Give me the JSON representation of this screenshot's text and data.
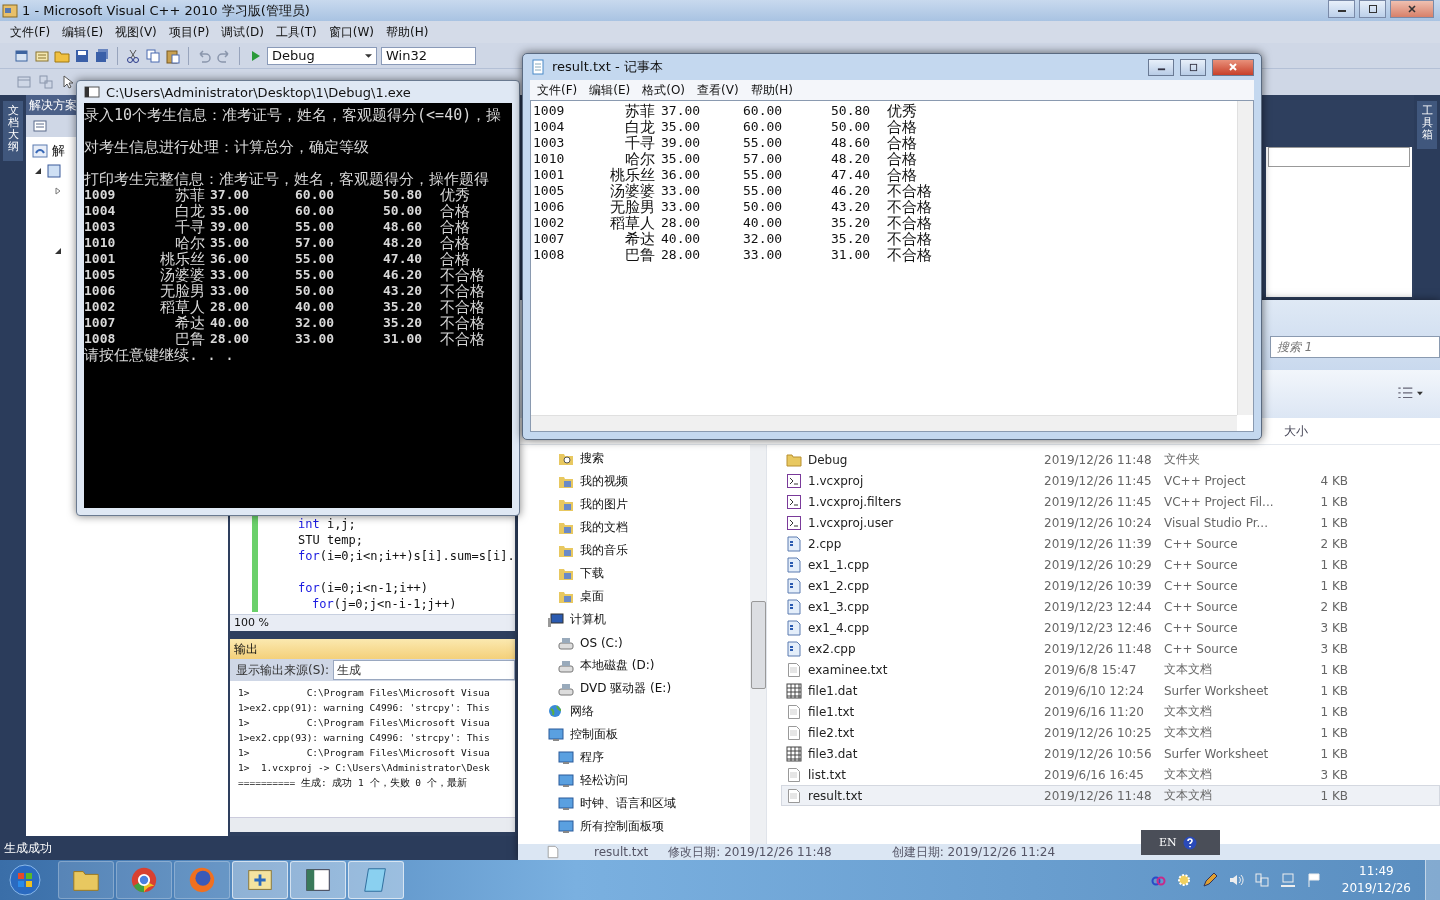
{
  "vs": {
    "title": "1 - Microsoft Visual C++ 2010 学习版(管理员)",
    "menu": [
      "文件(F)",
      "编辑(E)",
      "视图(V)",
      "项目(P)",
      "调试(D)",
      "工具(T)",
      "窗口(W)",
      "帮助(H)"
    ],
    "config": "Debug",
    "platform": "Win32",
    "left_tab": "文档大纲",
    "right_tab": "工具箱",
    "solution_explorer": {
      "title": "解决方案",
      "root": "解"
    },
    "code_blocks": [
      [
        {
          "tokens": [
            {
              "text": "int",
              "kind": "keyword"
            },
            {
              "text": " i,j;",
              "kind": "plain"
            }
          ]
        },
        {
          "tokens": [
            {
              "text": "STU temp;",
              "kind": "plain"
            }
          ]
        },
        {
          "tokens": [
            {
              "text": "for",
              "kind": "keyword"
            },
            {
              "text": "(i=0;i<n;i++)s[i].sum=s[i].",
              "kind": "plain"
            }
          ]
        }
      ],
      [
        {
          "tokens": [
            {
              "text": "for",
              "kind": "keyword"
            },
            {
              "text": "(i=0;i<n-1;i++)",
              "kind": "plain"
            }
          ],
          "children": [
            {
              "tokens": [
                {
                  "text": "for",
                  "kind": "keyword"
                },
                {
                  "text": "(j=0;j<n-i-1;j++)",
                  "kind": "plain"
                }
              ]
            }
          ]
        }
      ]
    ],
    "zoom": "100 %",
    "output": {
      "title": "输出",
      "source_label": "显示输出来源(S):",
      "source": "生成",
      "lines": [
        "1>          C:\\Program Files\\Microsoft Visua",
        "1>ex2.cpp(91): warning C4996: 'strcpy': This",
        "1>          C:\\Program Files\\Microsoft Visua",
        "1>ex2.cpp(93): warning C4996: 'strcpy': This",
        "1>          C:\\Program Files\\Microsoft Visua",
        "1>  1.vcxproj -> C:\\Users\\Administrator\\Desk",
        "========== 生成: 成功 1 个，失败 0 个，最新"
      ]
    },
    "status": "生成成功"
  },
  "console": {
    "title": "C:\\Users\\Administrator\\Desktop\\1\\Debug\\1.exe",
    "intro": [
      "录入10个考生信息：准考证号，姓名，客观题得分(<=40)，操",
      "对考生信息进行处理：计算总分，确定等级",
      "打印考生完整信息：准考证号，姓名，客观题得分，操作题得"
    ],
    "rows": [
      [
        "1009",
        "苏菲",
        "37.00",
        "60.00",
        "50.80",
        "优秀"
      ],
      [
        "1004",
        "白龙",
        "35.00",
        "60.00",
        "50.00",
        "合格"
      ],
      [
        "1003",
        "千寻",
        "39.00",
        "55.00",
        "48.60",
        "合格"
      ],
      [
        "1010",
        "哈尔",
        "35.00",
        "57.00",
        "48.20",
        "合格"
      ],
      [
        "1001",
        "桃乐丝",
        "36.00",
        "55.00",
        "47.40",
        "合格"
      ],
      [
        "1005",
        "汤婆婆",
        "33.00",
        "55.00",
        "46.20",
        "不合格"
      ],
      [
        "1006",
        "无脸男",
        "33.00",
        "50.00",
        "43.20",
        "不合格"
      ],
      [
        "1002",
        "稻草人",
        "28.00",
        "40.00",
        "35.20",
        "不合格"
      ],
      [
        "1007",
        "希达",
        "40.00",
        "32.00",
        "35.20",
        "不合格"
      ],
      [
        "1008",
        "巴鲁",
        "28.00",
        "33.00",
        "31.00",
        "不合格"
      ]
    ],
    "prompt": "请按任意键继续. . ."
  },
  "notepad": {
    "title": "result.txt - 记事本",
    "menu": [
      "文件(F)",
      "编辑(E)",
      "格式(O)",
      "查看(V)",
      "帮助(H)"
    ],
    "rows": [
      [
        "1009",
        "苏菲",
        "37.00",
        "60.00",
        "50.80",
        "优秀"
      ],
      [
        "1004",
        "白龙",
        "35.00",
        "60.00",
        "50.00",
        "合格"
      ],
      [
        "1003",
        "千寻",
        "39.00",
        "55.00",
        "48.60",
        "合格"
      ],
      [
        "1010",
        "哈尔",
        "35.00",
        "57.00",
        "48.20",
        "合格"
      ],
      [
        "1001",
        "桃乐丝",
        "36.00",
        "55.00",
        "47.40",
        "合格"
      ],
      [
        "1005",
        "汤婆婆",
        "33.00",
        "55.00",
        "46.20",
        "不合格"
      ],
      [
        "1006",
        "无脸男",
        "33.00",
        "50.00",
        "43.20",
        "不合格"
      ],
      [
        "1002",
        "稻草人",
        "28.00",
        "40.00",
        "35.20",
        "不合格"
      ],
      [
        "1007",
        "希达",
        "40.00",
        "32.00",
        "35.20",
        "不合格"
      ],
      [
        "1008",
        "巴鲁",
        "28.00",
        "33.00",
        "31.00",
        "不合格"
      ]
    ]
  },
  "explorer": {
    "search": {
      "placeholder": "搜索 1"
    },
    "size_header": "大小",
    "nav_upper": [
      {
        "label": "搜索",
        "kind": "search"
      },
      {
        "label": "我的视频",
        "kind": "library"
      },
      {
        "label": "我的图片",
        "kind": "library"
      },
      {
        "label": "我的文档",
        "kind": "library"
      },
      {
        "label": "我的音乐",
        "kind": "library"
      },
      {
        "label": "下载",
        "kind": "library"
      },
      {
        "label": "桌面",
        "kind": "library"
      }
    ],
    "nav_tree": [
      {
        "label": "计算机",
        "kind": "computer",
        "children": [
          {
            "label": "OS (C:)",
            "kind": "drive"
          },
          {
            "label": "本地磁盘 (D:)",
            "kind": "drive"
          },
          {
            "label": "DVD 驱动器 (E:)",
            "kind": "drive"
          }
        ]
      },
      {
        "label": "网络",
        "kind": "network"
      },
      {
        "label": "控制面板",
        "kind": "panel",
        "children": [
          {
            "label": "程序",
            "kind": "panel"
          },
          {
            "label": "轻松访问",
            "kind": "panel"
          },
          {
            "label": "时钟、语言和区域",
            "kind": "panel"
          },
          {
            "label": "所有控制面板项",
            "kind": "panel"
          }
        ]
      }
    ],
    "files": [
      {
        "name": "Debug",
        "date": "2019/12/26 11:48",
        "type": "文件夹",
        "kind": "folder",
        "selected": false
      },
      {
        "name": "1.vcxproj",
        "date": "2019/12/26 11:45",
        "type": "VC++ Project",
        "size": "4 KB",
        "kind": "project",
        "selected": false
      },
      {
        "name": "1.vcxproj.filters",
        "date": "2019/12/26 11:45",
        "type": "VC++ Project Fil...",
        "size": "1 KB",
        "kind": "project",
        "selected": false
      },
      {
        "name": "1.vcxproj.user",
        "date": "2019/12/26 10:24",
        "type": "Visual Studio Pr...",
        "size": "1 KB",
        "kind": "project",
        "selected": false
      },
      {
        "name": "2.cpp",
        "date": "2019/12/26 11:39",
        "type": "C++ Source",
        "size": "2 KB",
        "kind": "cpp",
        "selected": false
      },
      {
        "name": "ex1_1.cpp",
        "date": "2019/12/26 10:29",
        "type": "C++ Source",
        "size": "1 KB",
        "kind": "cpp",
        "selected": false
      },
      {
        "name": "ex1_2.cpp",
        "date": "2019/12/26 10:39",
        "type": "C++ Source",
        "size": "1 KB",
        "kind": "cpp",
        "selected": false
      },
      {
        "name": "ex1_3.cpp",
        "date": "2019/12/23 12:44",
        "type": "C++ Source",
        "size": "2 KB",
        "kind": "cpp",
        "selected": false
      },
      {
        "name": "ex1_4.cpp",
        "date": "2019/12/23 12:46",
        "type": "C++ Source",
        "size": "3 KB",
        "kind": "cpp",
        "selected": false
      },
      {
        "name": "ex2.cpp",
        "date": "2019/12/26 11:48",
        "type": "C++ Source",
        "size": "3 KB",
        "kind": "cpp",
        "selected": false
      },
      {
        "name": "examinee.txt",
        "date": "2019/6/8 15:47",
        "type": "文本文档",
        "size": "1 KB",
        "kind": "text",
        "selected": false
      },
      {
        "name": "file1.dat",
        "date": "2019/6/10 12:24",
        "type": "Surfer Worksheet",
        "size": "1 KB",
        "kind": "data",
        "selected": false
      },
      {
        "name": "file1.txt",
        "date": "2019/6/16 11:20",
        "type": "文本文档",
        "size": "1 KB",
        "kind": "text",
        "selected": false
      },
      {
        "name": "file2.txt",
        "date": "2019/12/26 10:25",
        "type": "文本文档",
        "size": "1 KB",
        "kind": "text",
        "selected": false
      },
      {
        "name": "file3.dat",
        "date": "2019/12/26 10:56",
        "type": "Surfer Worksheet",
        "size": "1 KB",
        "kind": "data",
        "selected": false
      },
      {
        "name": "list.txt",
        "date": "2019/6/16 16:45",
        "type": "文本文档",
        "size": "3 KB",
        "kind": "text",
        "selected": false
      },
      {
        "name": "result.txt",
        "date": "2019/12/26 11:48",
        "type": "文本文档",
        "size": "1 KB",
        "kind": "text",
        "selected": true
      }
    ],
    "details": {
      "name": "result.txt",
      "modified": "修改日期: 2019/12/26 11:48",
      "created": "创建日期: 2019/12/26 11:24"
    }
  },
  "ime": {
    "language": "EN"
  },
  "taskbar": {
    "apps": [
      {
        "kind": "folder",
        "active": false
      },
      {
        "kind": "chrome",
        "active": false
      },
      {
        "kind": "firefox",
        "active": false
      },
      {
        "kind": "tool",
        "active": true
      },
      {
        "kind": "ide",
        "active": true
      },
      {
        "kind": "notepad",
        "active": true
      }
    ],
    "time": "11:49",
    "date": "2019/12/26"
  }
}
